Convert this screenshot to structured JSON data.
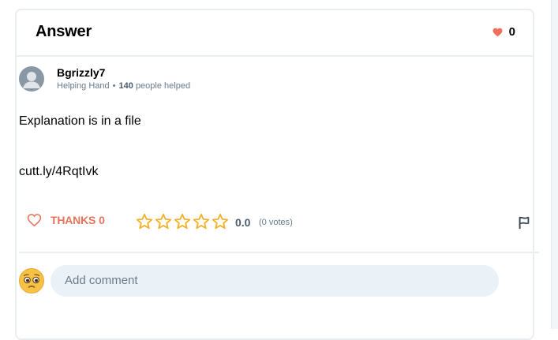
{
  "header": {
    "title": "Answer",
    "likes_count": "0"
  },
  "author": {
    "name": "Bgrizzly7",
    "rank": "Helping Hand",
    "separator": "•",
    "helped_count": "140",
    "helped_label": "people helped"
  },
  "answer": {
    "line1": "Explanation is in a file",
    "line2": "cutt.ly/4RqtIvk"
  },
  "actions": {
    "thanks_label": "THANKS",
    "thanks_count": "0",
    "rating_value": "0.0",
    "rating_stars_filled": 0,
    "rating_stars_total": 5,
    "votes_text": "(0 votes)"
  },
  "comment": {
    "placeholder": "Add comment"
  },
  "colors": {
    "accent": "#e8735b",
    "star": "#f5b02a",
    "heart_fill": "#ef6f5a",
    "comment_bg": "#ebf2f7",
    "muted": "#687b8c"
  },
  "icons": {
    "likes": "heart-filled-icon",
    "thanks": "heart-outline-icon",
    "rating": "star-outline-icon",
    "report": "flag-icon",
    "avatar": "user-avatar-icon",
    "commenter": "pleading-face-emoji-icon"
  }
}
